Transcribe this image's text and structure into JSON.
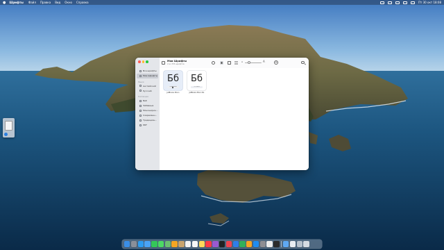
{
  "menubar": {
    "app_name": "Шрифты",
    "menus": [
      "Файл",
      "Правка",
      "Вид",
      "Окно",
      "Справка"
    ],
    "clock": "Пт 30 окт 18:08"
  },
  "window": {
    "title": "Мои Шрифты",
    "subtitle": "2 из 335 шрифтов",
    "sidebar": {
      "top_items": [
        {
          "label": "Все шрифты",
          "icon": "font-collection-icon",
          "selected": false
        },
        {
          "label": "Мои Шрифты",
          "icon": "user-fonts-icon",
          "selected": true
        }
      ],
      "languages_header": "Языки",
      "language_items": [
        {
          "label": "Английский",
          "icon": "language-icon"
        },
        {
          "label": "Русский",
          "icon": "language-icon"
        }
      ],
      "collections_header": "Коллекции",
      "collection_items": [
        {
          "label": "Веб",
          "icon": "collection-icon"
        },
        {
          "label": "Забавные",
          "icon": "collection-icon"
        },
        {
          "label": "Моноширин...",
          "icon": "collection-icon"
        },
        {
          "label": "Современн...",
          "icon": "collection-icon"
        },
        {
          "label": "Традицион...",
          "icon": "collection-icon"
        },
        {
          "label": "PDF",
          "icon": "collection-icon"
        }
      ]
    },
    "fonts": [
      {
        "glyph": "Бб",
        "badge": "Обычный",
        "name": "JetBrains Mono",
        "selected": true
      },
      {
        "glyph": "Бб",
        "badge": "3 стиля",
        "name": "JetBrains Mono NL",
        "selected": false
      }
    ]
  },
  "dock": {
    "icons": [
      {
        "name": "finder-icon",
        "color": "#3a8ee6"
      },
      {
        "name": "launchpad-icon",
        "color": "#8a8f99"
      },
      {
        "name": "safari-icon",
        "color": "#2d9cf0"
      },
      {
        "name": "mail-icon",
        "color": "#4aa3f5"
      },
      {
        "name": "facetime-icon",
        "color": "#34c759"
      },
      {
        "name": "messages-icon",
        "color": "#4cd964"
      },
      {
        "name": "maps-icon",
        "color": "#6cc070"
      },
      {
        "name": "photos-icon",
        "color": "#f5a623"
      },
      {
        "name": "contacts-icon",
        "color": "#c8a46e"
      },
      {
        "name": "calendar-icon",
        "color": "#f2f2f2"
      },
      {
        "name": "reminders-icon",
        "color": "#f7f7f7"
      },
      {
        "name": "notes-icon",
        "color": "#ffd95a"
      },
      {
        "name": "music-icon",
        "color": "#fc3c44"
      },
      {
        "name": "podcasts-icon",
        "color": "#9b59d0"
      },
      {
        "name": "tv-icon",
        "color": "#222222"
      },
      {
        "name": "news-icon",
        "color": "#f0454f"
      },
      {
        "name": "keynote-icon",
        "color": "#2f7ee8"
      },
      {
        "name": "numbers-icon",
        "color": "#31b05a"
      },
      {
        "name": "pages-icon",
        "color": "#f6a623"
      },
      {
        "name": "app-store-icon",
        "color": "#1e8cf0"
      },
      {
        "name": "system-preferences-icon",
        "color": "#8e8e93"
      },
      {
        "name": "font-book-icon",
        "color": "#ececec"
      },
      {
        "name": "terminal-icon",
        "color": "#2b2b2b"
      },
      {
        "name": "downloads-folder-icon",
        "color": "#5fa8f2"
      },
      {
        "name": "document-icon",
        "color": "#e9edf2"
      },
      {
        "name": "screenshot-icon",
        "color": "#b7c1cc"
      },
      {
        "name": "trash-icon",
        "color": "#d6dbe2"
      }
    ]
  }
}
